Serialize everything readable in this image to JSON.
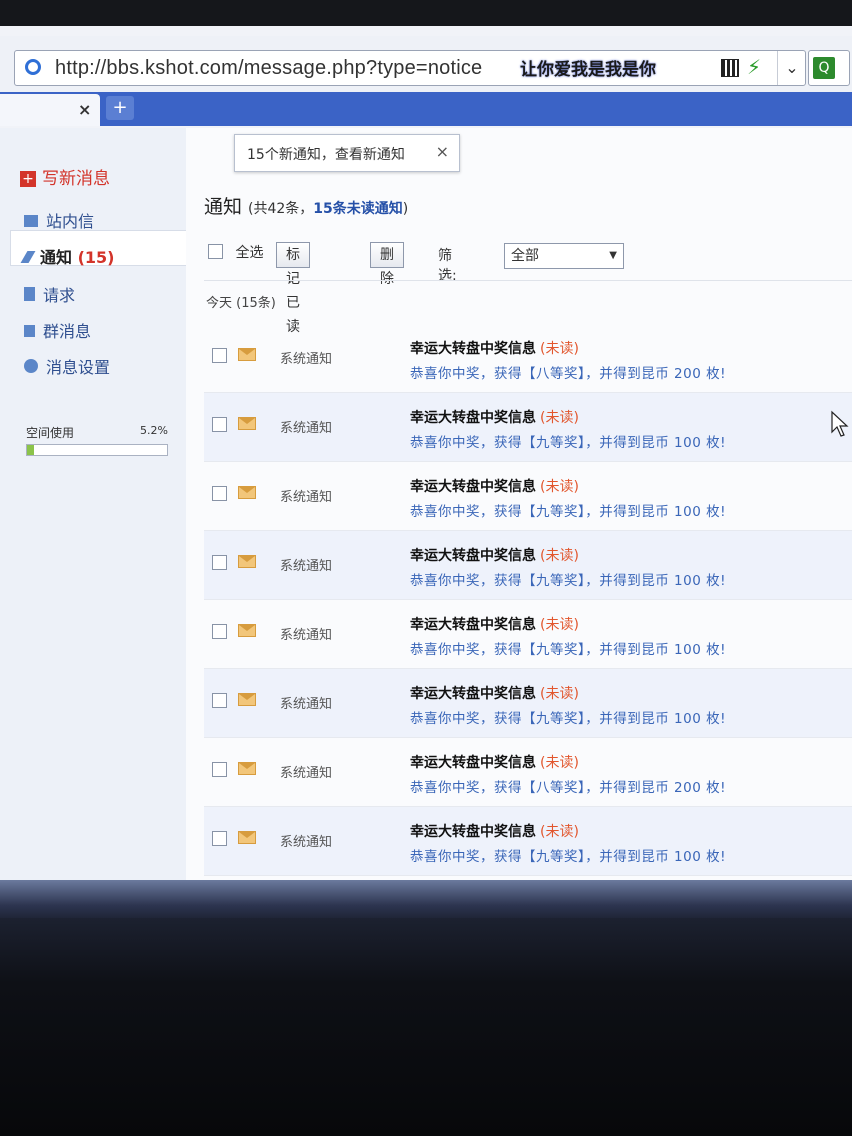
{
  "browser": {
    "url": "http://bbs.kshot.com/message.php?type=notice",
    "overlay_text": "让你爱我是我是你",
    "tab_close": "×",
    "new_tab": "+"
  },
  "sidebar": {
    "compose": "写新消息",
    "items": [
      {
        "label": "站内信",
        "icon": "envelope-icon"
      },
      {
        "label": "通知",
        "count": "(15)",
        "icon": "pencil-icon",
        "active": true
      },
      {
        "label": "请求",
        "icon": "doc-icon"
      },
      {
        "label": "群消息",
        "icon": "flag-icon"
      },
      {
        "label": "消息设置",
        "icon": "globe-icon"
      }
    ],
    "storage": {
      "label": "空间使用",
      "percent_text": "5.2%",
      "percent": 0.052
    }
  },
  "toast": {
    "text": "15个新通知，查看新通知",
    "close": "×"
  },
  "header": {
    "title": "通知",
    "summary_prefix": "(共42条，",
    "summary_unread": "15条未读通知",
    "summary_suffix": ")"
  },
  "toolbar": {
    "select_all": "全选",
    "mark_read": "标记已读",
    "delete": "删除",
    "filter_label": "筛选:",
    "filter_value": "全部"
  },
  "group_label": "今天 (15条)",
  "rows": [
    {
      "type": "系统通知",
      "title": "幸运大转盘中奖信息",
      "status": "(未读)",
      "body": "恭喜你中奖，获得【八等奖】，并得到昆币 200 枚!"
    },
    {
      "type": "系统通知",
      "title": "幸运大转盘中奖信息",
      "status": "(未读)",
      "body": "恭喜你中奖，获得【九等奖】，并得到昆币 100 枚!"
    },
    {
      "type": "系统通知",
      "title": "幸运大转盘中奖信息",
      "status": "(未读)",
      "body": "恭喜你中奖，获得【九等奖】，并得到昆币 100 枚!"
    },
    {
      "type": "系统通知",
      "title": "幸运大转盘中奖信息",
      "status": "(未读)",
      "body": "恭喜你中奖，获得【九等奖】，并得到昆币 100 枚!"
    },
    {
      "type": "系统通知",
      "title": "幸运大转盘中奖信息",
      "status": "(未读)",
      "body": "恭喜你中奖，获得【九等奖】，并得到昆币 100 枚!"
    },
    {
      "type": "系统通知",
      "title": "幸运大转盘中奖信息",
      "status": "(未读)",
      "body": "恭喜你中奖，获得【九等奖】，并得到昆币 100 枚!"
    },
    {
      "type": "系统通知",
      "title": "幸运大转盘中奖信息",
      "status": "(未读)",
      "body": "恭喜你中奖，获得【八等奖】，并得到昆币 200 枚!"
    },
    {
      "type": "系统通知",
      "title": "幸运大转盘中奖信息",
      "status": "(未读)",
      "body": "恭喜你中奖，获得【九等奖】，并得到昆币 100 枚!"
    }
  ]
}
